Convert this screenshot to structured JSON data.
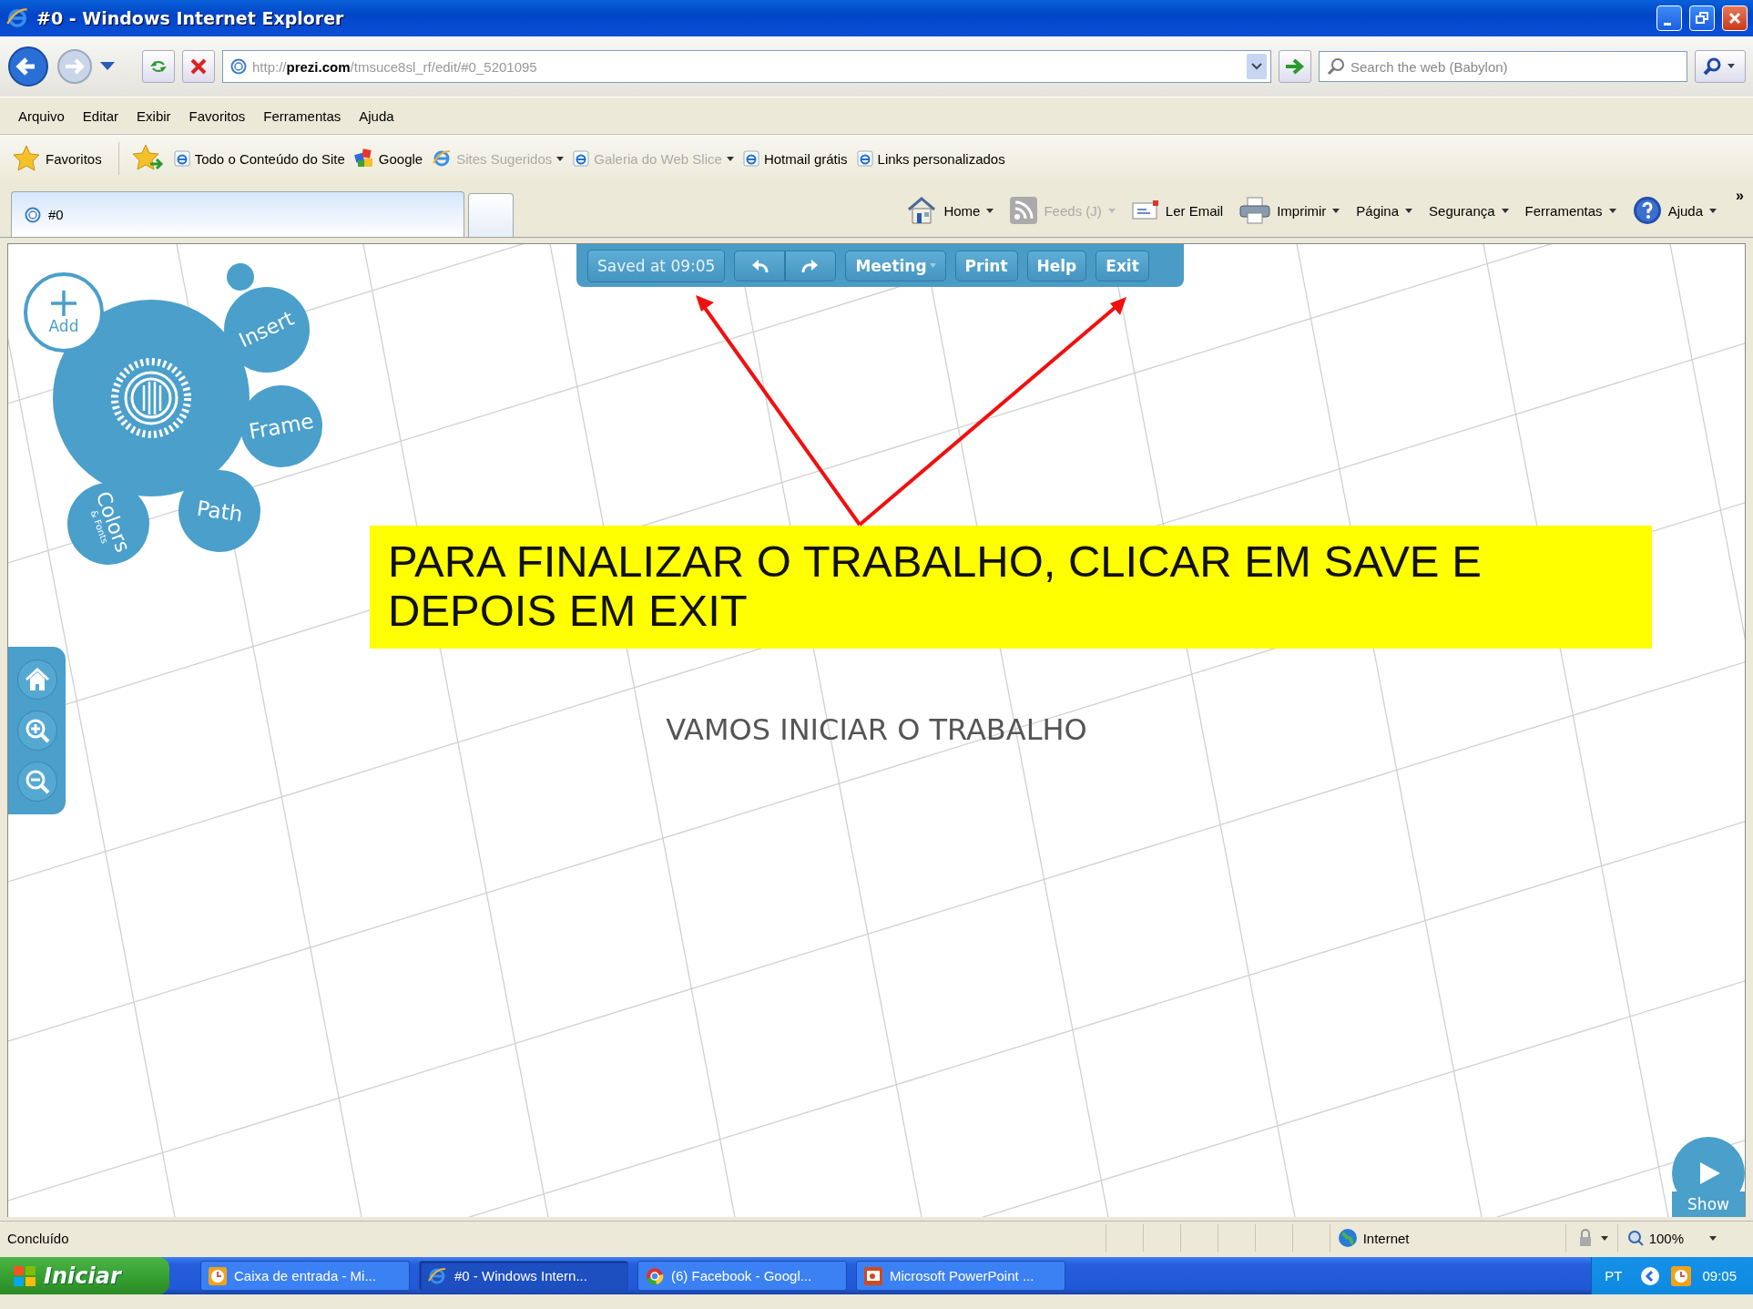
{
  "window": {
    "title": "#0 - Windows Internet Explorer"
  },
  "address_bar": {
    "url": "http://**prezi.com**/tmsuce8sl_rf/edit/#0_5201095"
  },
  "search": {
    "placeholder": "Search the web (Babylon)"
  },
  "menu": [
    "Arquivo",
    "Editar",
    "Exibir",
    "Favoritos",
    "Ferramentas",
    "Ajuda"
  ],
  "favorites_bar": {
    "label": "Favoritos",
    "links": [
      {
        "label": "Todo o Conteúdo do Site",
        "kind": "page",
        "disabled": false,
        "dropdown": false
      },
      {
        "label": "Google",
        "kind": "google",
        "disabled": false,
        "dropdown": false
      },
      {
        "label": "Sites Sugeridos",
        "kind": "ie",
        "disabled": true,
        "dropdown": true
      },
      {
        "label": "Galeria do Web Slice",
        "kind": "page",
        "disabled": true,
        "dropdown": true
      },
      {
        "label": "Hotmail grátis",
        "kind": "page",
        "disabled": false,
        "dropdown": false
      },
      {
        "label": "Links personalizados",
        "kind": "page",
        "disabled": false,
        "dropdown": false
      }
    ]
  },
  "tabs": [
    {
      "label": "#0",
      "selected": true
    }
  ],
  "command_bar": {
    "overflow": "»",
    "items": [
      {
        "label": "Home",
        "kind": "home",
        "disabled": false,
        "dropdown": true
      },
      {
        "label": "Feeds (J)",
        "kind": "feeds",
        "disabled": true,
        "dropdown": true
      },
      {
        "label": "Ler Email",
        "kind": "mail",
        "disabled": false,
        "dropdown": false
      },
      {
        "label": "Imprimir",
        "kind": "print",
        "disabled": false,
        "dropdown": true
      },
      {
        "label": "Página",
        "kind": "text",
        "disabled": false,
        "dropdown": true
      },
      {
        "label": "Segurança",
        "kind": "text",
        "disabled": false,
        "dropdown": true
      },
      {
        "label": "Ferramentas",
        "kind": "text",
        "disabled": false,
        "dropdown": true
      },
      {
        "label": "Ajuda",
        "kind": "help",
        "disabled": false,
        "dropdown": true
      }
    ]
  },
  "prezi_toolbar": {
    "status": "Saved at 09:05",
    "buttons": [
      {
        "label": "Meeting",
        "dropdown": true
      },
      {
        "label": "Print",
        "dropdown": false
      },
      {
        "label": "Help",
        "dropdown": false
      },
      {
        "label": "Exit",
        "dropdown": false
      }
    ]
  },
  "bubble_menu": {
    "add": "Add",
    "items": [
      {
        "label": "Insert"
      },
      {
        "label": "Frame"
      },
      {
        "label": "Path"
      },
      {
        "label": "Colors",
        "sublabel": "& Fonts"
      }
    ]
  },
  "canvas": {
    "note": "PARA FINALIZAR O TRABALHO, CLICAR EM SAVE E DEPOIS EM EXIT",
    "title": "VAMOS INICIAR O TRABALHO",
    "show_button": "Show"
  },
  "status_bar": {
    "text": "Concluído",
    "zone": "Internet",
    "zoom": "100%"
  },
  "taskbar": {
    "start": "Iniciar",
    "tasks": [
      {
        "label": "Caixa de entrada - Mi...",
        "kind": "outlook",
        "selected": false
      },
      {
        "label": "#0 - Windows Intern...",
        "kind": "ie",
        "selected": true
      },
      {
        "label": "(6) Facebook - Googl...",
        "kind": "chrome",
        "selected": false
      },
      {
        "label": "Microsoft PowerPoint ...",
        "kind": "powerpoint",
        "selected": false
      }
    ],
    "language": "PT",
    "clock": "09:05"
  }
}
